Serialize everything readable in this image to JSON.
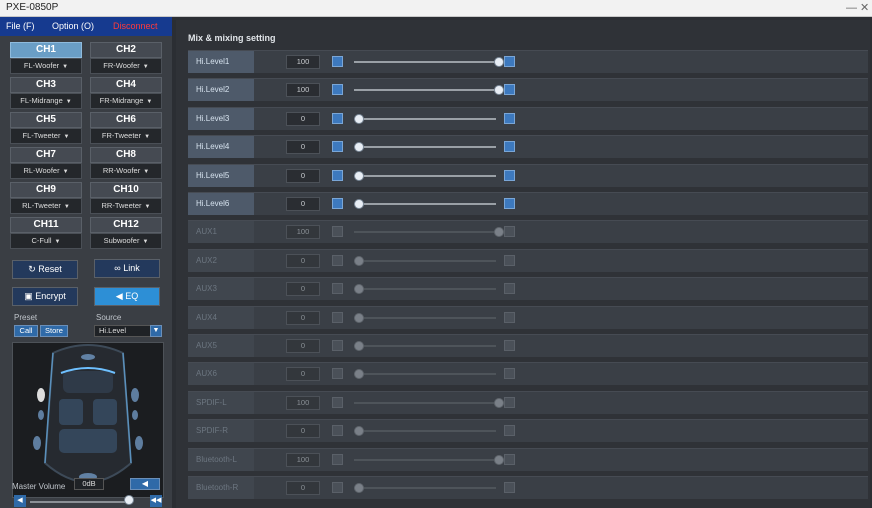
{
  "window": {
    "title": "PXE-0850P",
    "controls": "— ✕"
  },
  "menu": {
    "file": "File (F)",
    "option": "Option (O)",
    "status": "Disconnect"
  },
  "channels": [
    {
      "label": "CH1",
      "assign": "FL-Woofer"
    },
    {
      "label": "CH2",
      "assign": "FR-Woofer"
    },
    {
      "label": "CH3",
      "assign": "FL-Midrange"
    },
    {
      "label": "CH4",
      "assign": "FR-Midrange"
    },
    {
      "label": "CH5",
      "assign": "FL-Tweeter"
    },
    {
      "label": "CH6",
      "assign": "FR-Tweeter"
    },
    {
      "label": "CH7",
      "assign": "RL-Woofer"
    },
    {
      "label": "CH8",
      "assign": "RR-Woofer"
    },
    {
      "label": "CH9",
      "assign": "RL-Tweeter"
    },
    {
      "label": "CH10",
      "assign": "RR-Tweeter"
    },
    {
      "label": "CH11",
      "assign": "C-Full"
    },
    {
      "label": "CH12",
      "assign": "Subwoofer"
    }
  ],
  "buttons": {
    "reset": "Reset",
    "link": "Link",
    "encrypt": "Encrypt",
    "eq": "EQ"
  },
  "preset": {
    "label": "Preset",
    "call": "Call",
    "store": "Store"
  },
  "source": {
    "label": "Source",
    "value": "Hi.Level"
  },
  "master": {
    "label": "Master Volume",
    "value": "0dB"
  },
  "main": {
    "title": "Mix & mixing setting",
    "rows": [
      {
        "name": "Hi.Level1",
        "value": "100",
        "level": 100,
        "enabled": true
      },
      {
        "name": "Hi.Level2",
        "value": "100",
        "level": 100,
        "enabled": true
      },
      {
        "name": "Hi.Level3",
        "value": "0",
        "level": 0,
        "enabled": true
      },
      {
        "name": "Hi.Level4",
        "value": "0",
        "level": 0,
        "enabled": true
      },
      {
        "name": "Hi.Level5",
        "value": "0",
        "level": 0,
        "enabled": true
      },
      {
        "name": "Hi.Level6",
        "value": "0",
        "level": 0,
        "enabled": true
      },
      {
        "name": "AUX1",
        "value": "100",
        "level": 100,
        "enabled": false
      },
      {
        "name": "AUX2",
        "value": "0",
        "level": 0,
        "enabled": false
      },
      {
        "name": "AUX3",
        "value": "0",
        "level": 0,
        "enabled": false
      },
      {
        "name": "AUX4",
        "value": "0",
        "level": 0,
        "enabled": false
      },
      {
        "name": "AUX5",
        "value": "0",
        "level": 0,
        "enabled": false
      },
      {
        "name": "AUX6",
        "value": "0",
        "level": 0,
        "enabled": false
      },
      {
        "name": "SPDIF-L",
        "value": "100",
        "level": 100,
        "enabled": false
      },
      {
        "name": "SPDIF-R",
        "value": "0",
        "level": 0,
        "enabled": false
      },
      {
        "name": "Bluetooth-L",
        "value": "100",
        "level": 100,
        "enabled": false
      },
      {
        "name": "Bluetooth-R",
        "value": "0",
        "level": 0,
        "enabled": false
      }
    ]
  },
  "icons": {
    "reset": "reset-icon",
    "link": "link-icon",
    "encrypt": "lock-icon",
    "eq": "back-arrow-icon"
  },
  "colors": {
    "menu_bg": "#163a8f",
    "disconnect": "#ff3a3a",
    "active_channel": "#6a9ec6",
    "accent": "#3d79be"
  }
}
